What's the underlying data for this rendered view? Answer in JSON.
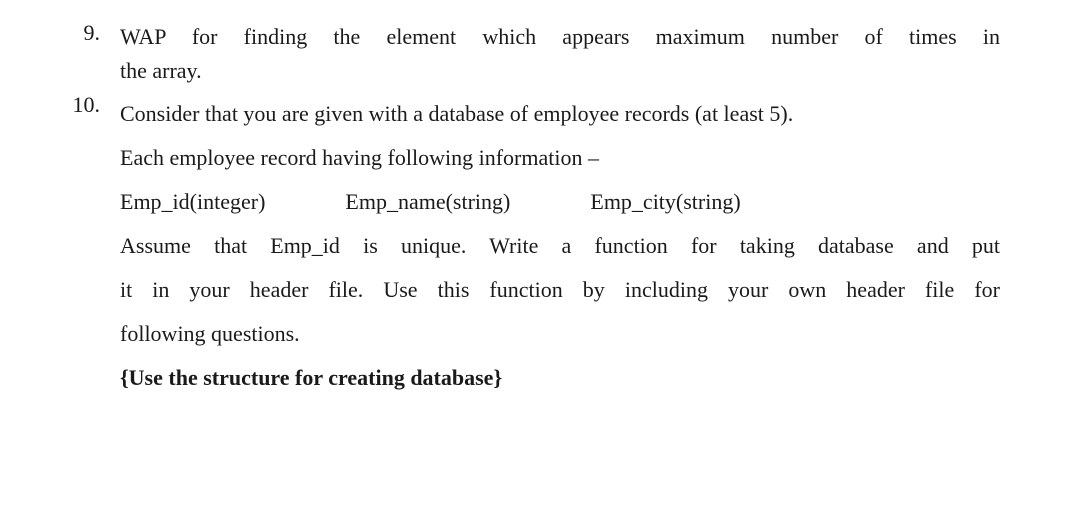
{
  "items": [
    {
      "number": "9.",
      "line1": "WAP for finding the element which appears maximum number of times in",
      "line2": "the array."
    },
    {
      "number": "10.",
      "line1": "Consider that you are given with a database of employee records (at least 5).",
      "line2": "Each employee record having following information –",
      "fields": {
        "f1": "Emp_id(integer)",
        "f2": "Emp_name(string)",
        "f3": "Emp_city(string)"
      },
      "line3": "Assume that Emp_id is unique. Write a function for taking database and put",
      "line4": "it in your header file. Use this function by including your own header file for",
      "line5": "following questions.",
      "noteBold": "{Use the structure for creating database}"
    }
  ]
}
